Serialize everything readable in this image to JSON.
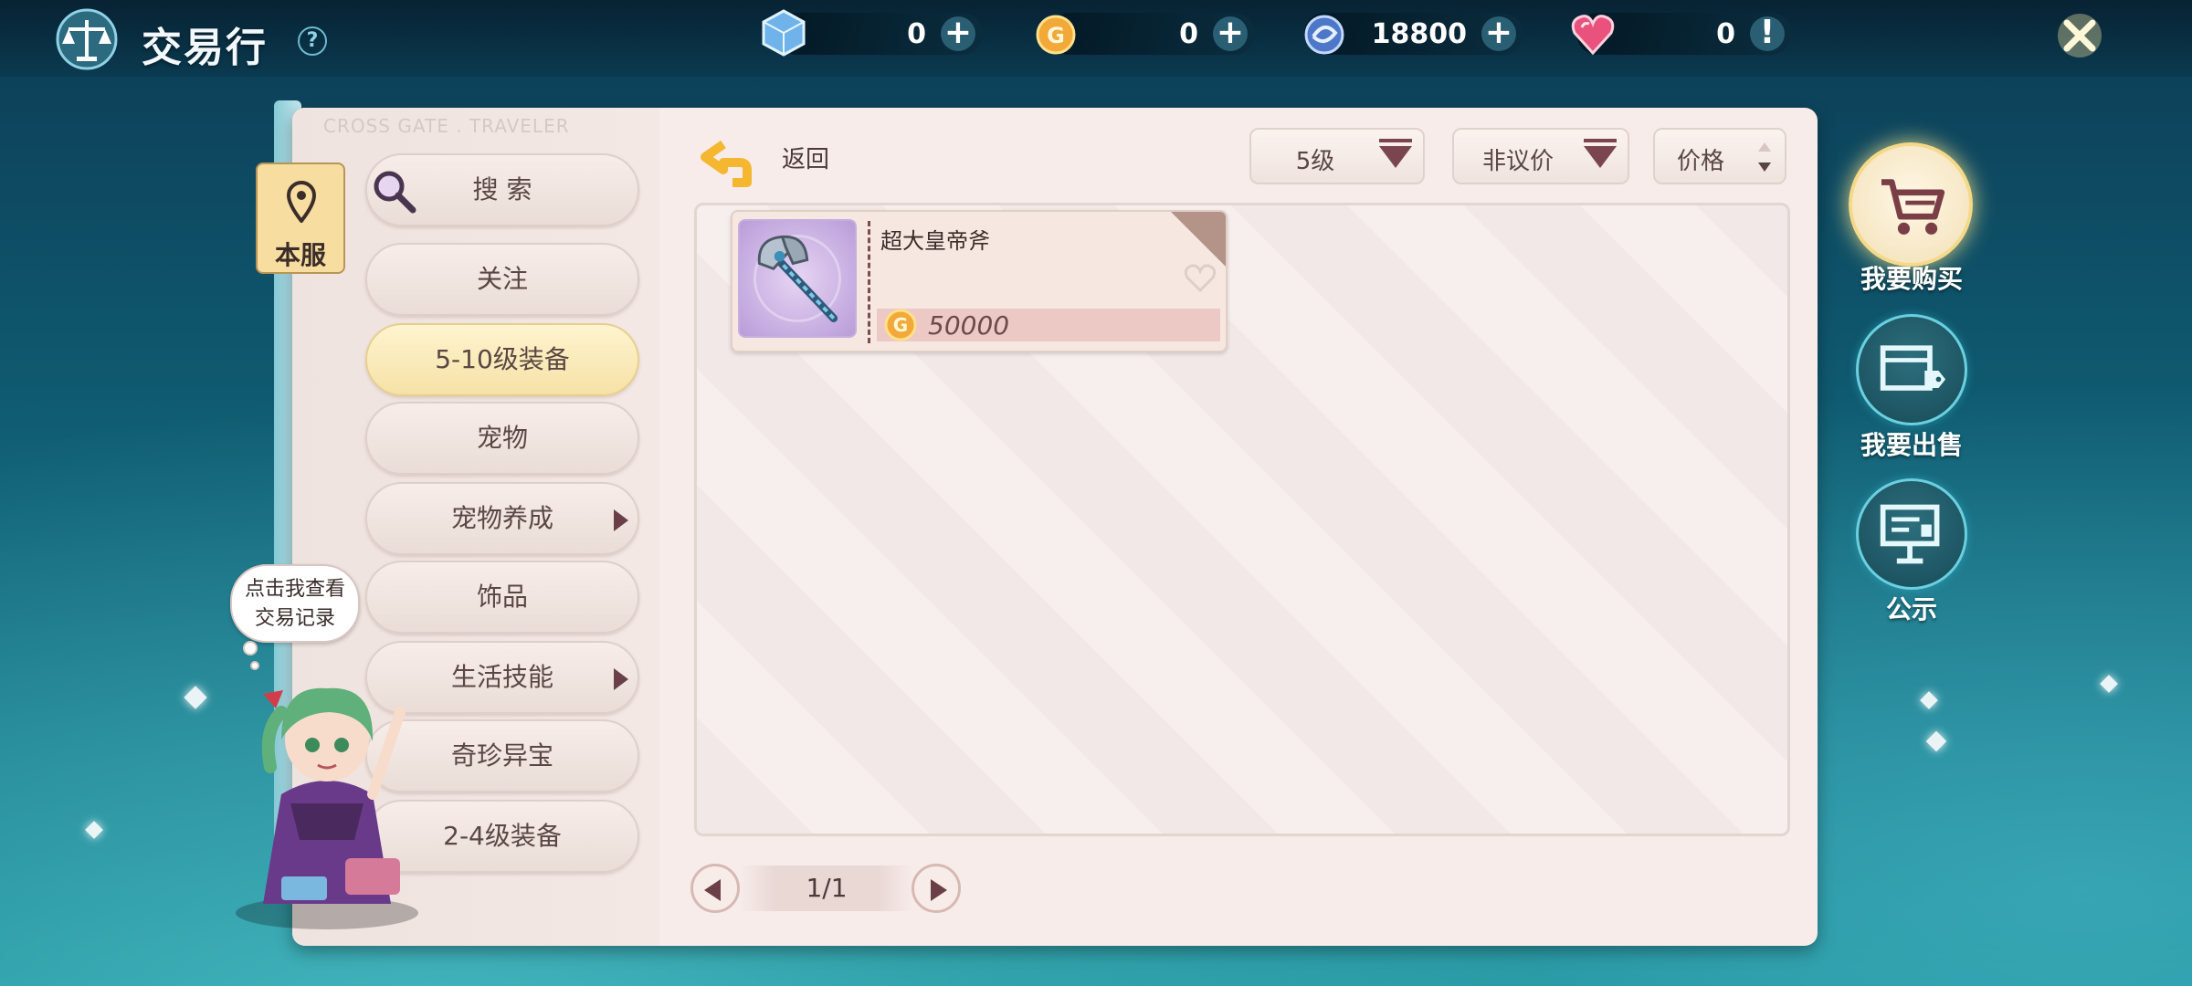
{
  "header": {
    "title": "交易行",
    "help_glyph": "?",
    "close_glyph": "✕"
  },
  "currencies": [
    {
      "icon": "crystal-cube-icon",
      "value": "0",
      "action": "+"
    },
    {
      "icon": "gold-coin-icon",
      "value": "0",
      "action": "+"
    },
    {
      "icon": "blue-token-icon",
      "value": "18800",
      "action": "+"
    },
    {
      "icon": "heart-gem-icon",
      "value": "0",
      "action": "!"
    }
  ],
  "panel": {
    "watermark": "CROSS GATE . TRAVELER",
    "server_tag": "本服"
  },
  "categories": [
    {
      "label": "搜 索",
      "icon": "magnifier-icon"
    },
    {
      "label": "关注"
    },
    {
      "label": "5-10级装备",
      "active": true
    },
    {
      "label": "宠物"
    },
    {
      "label": "宠物养成",
      "submenu": true
    },
    {
      "label": "饰品"
    },
    {
      "label": "生活技能",
      "submenu": true
    },
    {
      "label": "奇珍异宝"
    },
    {
      "label": "2-4级装备"
    }
  ],
  "toolbar": {
    "back_label": "返回",
    "level_filter": "5级",
    "price_type_filter": "非议价",
    "sort_label": "价格"
  },
  "listings": [
    {
      "name": "超大皇帝斧",
      "price": "50000",
      "currency_icon": "gold-coin-icon",
      "thumb_icon": "battle-axe-icon"
    }
  ],
  "pagination": {
    "text": "1/1"
  },
  "side_menu": [
    {
      "label": "我要购买",
      "icon": "cart-icon",
      "active": true
    },
    {
      "label": "我要出售",
      "icon": "sell-box-icon"
    },
    {
      "label": "公示",
      "icon": "notice-board-icon"
    }
  ],
  "guide": {
    "bubble_line1": "点击我查看",
    "bubble_line2": "交易记录"
  },
  "colors": {
    "accent_teal": "#6ad0df",
    "active_category": "#f6e2a6",
    "panel_bg": "#f7ecea",
    "price_bar": "#ecc9c5",
    "dropdown_arrow": "#7b4550"
  }
}
